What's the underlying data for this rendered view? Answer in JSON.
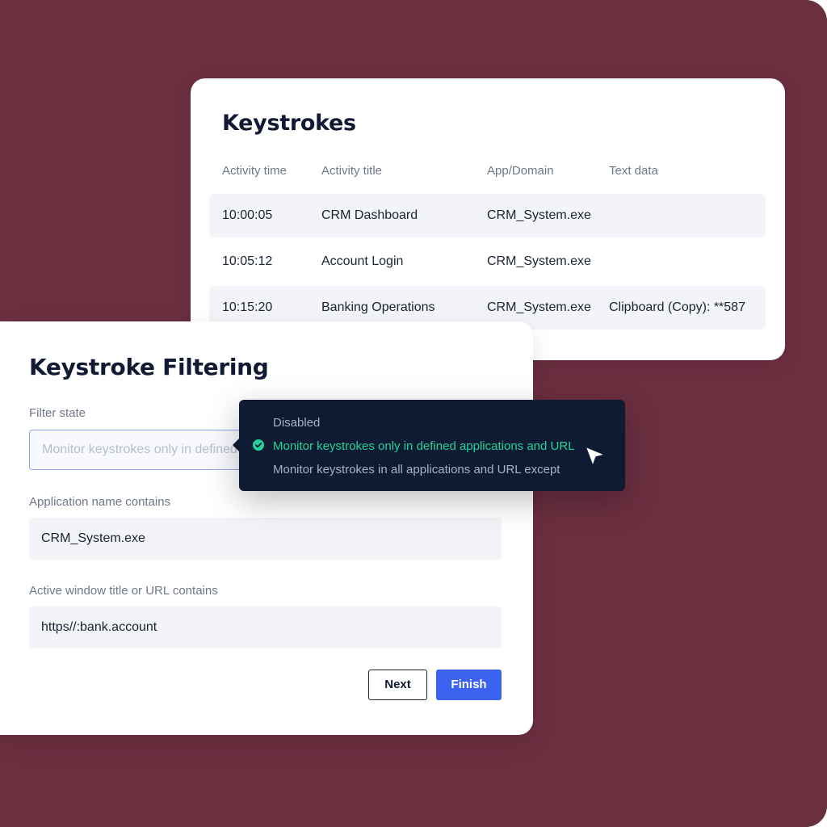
{
  "keystrokes": {
    "title": "Keystrokes",
    "columns": [
      "Activity time",
      "Activity title",
      "App/Domain",
      "Text data"
    ],
    "rows": [
      {
        "time": "10:00:05",
        "title": "CRM Dashboard",
        "app": "CRM_System.exe",
        "text": ""
      },
      {
        "time": "10:05:12",
        "title": "Account Login",
        "app": "CRM_System.exe",
        "text": ""
      },
      {
        "time": "10:15:20",
        "title": "Banking Operations",
        "app": "CRM_System.exe",
        "text": "Clipboard (Copy): **587"
      }
    ]
  },
  "filtering": {
    "title": "Keystroke Filtering",
    "filter_state_label": "Filter state",
    "filter_state_value": "Monitor keystrokes only in defined applications and URL",
    "app_name_label": "Application name contains",
    "app_name_value": "CRM_System.exe",
    "window_label": "Active window title or URL contains",
    "window_value": "https//:bank.account",
    "next_label": "Next",
    "finish_label": "Finish"
  },
  "dropdown": {
    "options": [
      "Disabled",
      "Monitor keystrokes only in defined applications and URL",
      "Monitor keystrokes in all applications and URL except"
    ],
    "selected_index": 1
  },
  "colors": {
    "background": "#6b2f40",
    "accent": "#3b63f0",
    "selected": "#22d39a",
    "popup": "#0f1a33"
  }
}
